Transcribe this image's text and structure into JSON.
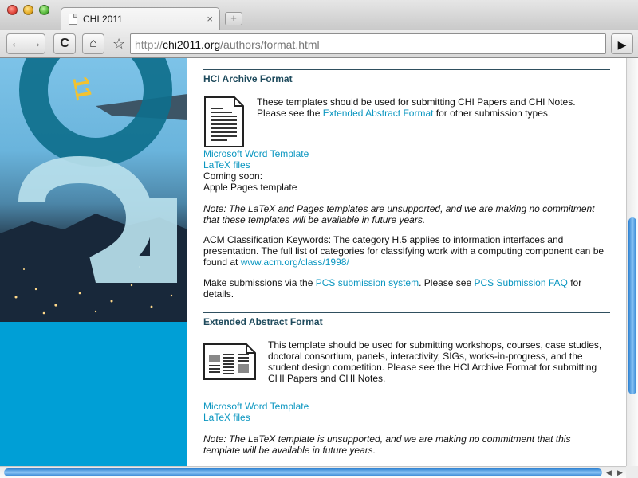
{
  "browser": {
    "tab_title": "CHI 2011",
    "tab_close": "×",
    "new_tab": "+",
    "url_scheme": "http://",
    "url_host": "chi2011.org",
    "url_path": "/authors/format.html",
    "back_icon": "←",
    "forward_icon": "→",
    "reload_icon": "C",
    "home_icon": "⌂",
    "bookmark_icon": "☆",
    "go_icon": "▶"
  },
  "logo": {
    "small_numerals": "11"
  },
  "hci": {
    "title": "HCI Archive Format",
    "intro_1": "These templates should be used for submitting CHI Papers and CHI Notes.",
    "intro_2_pre": "Please see the ",
    "intro_2_link": "Extended Abstract Format",
    "intro_2_post": " for other submission types.",
    "link_word": "Microsoft Word Template",
    "link_latex": "LaTeX files",
    "coming_soon": "Coming soon:",
    "pages": "Apple Pages template",
    "note_1": "Note: The LaTeX and Pages templates are unsupported, and we are making no commitment",
    "note_2": "that these templates will be available in future years.",
    "acm_1": "ACM Classification Keywords: The category H.5 applies to information interfaces and",
    "acm_2": "presentation. The full list of categories for classifying work with a computing component can be",
    "acm_3_pre": "found at ",
    "acm_3_link": "www.acm.org/class/1998/",
    "pcs_1_pre": "Make submissions via the ",
    "pcs_1_link": "PCS submission system",
    "pcs_1_mid": ". Please see ",
    "pcs_1_link2": "PCS Submission FAQ",
    "pcs_1_post": " for",
    "pcs_2": "details."
  },
  "extended": {
    "title": "Extended Abstract Format",
    "intro_1": "This template should be used for submitting workshops, courses, case studies,",
    "intro_2": "doctoral consortium, panels, interactivity, SIGs, works-in-progress, and the",
    "intro_3": "student design competition. Please see the HCI Archive Format for submitting",
    "intro_4": "CHI Papers and CHI Notes.",
    "link_word": "Microsoft Word Template",
    "link_latex": "LaTeX files",
    "note_1": "Note: The LaTeX template is unsupported, and we are making no commitment that this",
    "note_2": "template will be available in future years."
  },
  "scroll": {
    "left_arrow": "◀",
    "right_arrow": "▶"
  },
  "colors": {
    "link": "#0a96c0",
    "heading": "#1e4a5c",
    "sidebar_blue": "#009fd6"
  }
}
